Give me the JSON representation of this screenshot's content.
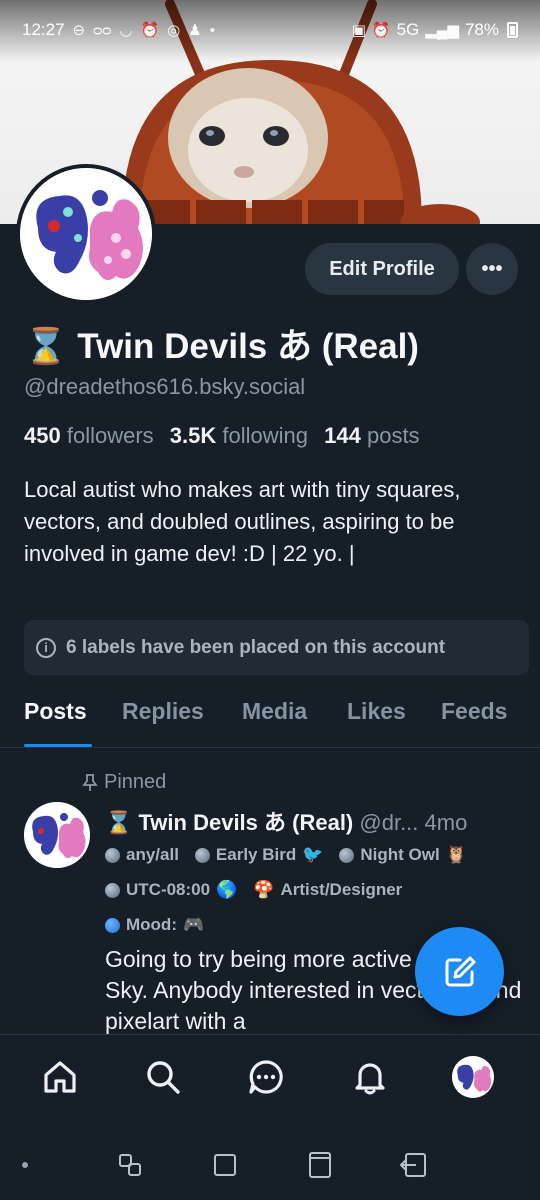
{
  "status_bar": {
    "time": "12:27",
    "network": "5G",
    "battery": "78%"
  },
  "profile": {
    "edit_button": "Edit Profile",
    "more_button": "•••",
    "display_name": "⌛ Twin Devils あ (Real)",
    "handle": "@dreadethos616.bsky.social",
    "followers_count": "450",
    "followers_label": "followers",
    "following_count": "3.5K",
    "following_label": "following",
    "posts_count": "144",
    "posts_label": "posts",
    "bio": "Local autist who makes art with tiny squares, vectors, and doubled outlines, aspiring to be involved in game dev! :D | 22 yo. |",
    "labels_notice": "6 labels have been placed on this account"
  },
  "tabs": [
    {
      "label": "Posts",
      "active": true
    },
    {
      "label": "Replies",
      "active": false
    },
    {
      "label": "Media",
      "active": false
    },
    {
      "label": "Likes",
      "active": false
    },
    {
      "label": "Feeds",
      "active": false
    }
  ],
  "post": {
    "pinned_label": "Pinned",
    "author_name": "⌛ Twin Devils あ (Real)",
    "author_handle": "@dr...",
    "time": "4mo",
    "badges": {
      "any_all": "any/all",
      "early_bird": "Early Bird",
      "early_bird_emoji": "🐦",
      "night_owl": "Night Owl",
      "night_owl_emoji": "🦉",
      "timezone": "UTC-08:00",
      "timezone_emoji": "🌎",
      "artist": "Artist/Designer",
      "mood": "Mood:",
      "mood_emoji": "🎮"
    },
    "text": "Going to try being more active on Blue Sky. Anybody interested in vector art and pixelart with a"
  },
  "bottom_nav": [
    "home-icon",
    "search-icon",
    "chat-icon",
    "bell-icon",
    "profile-avatar"
  ],
  "colors": {
    "background": "#161e27",
    "accent": "#1d8bf3",
    "muted": "#8a97a6"
  }
}
